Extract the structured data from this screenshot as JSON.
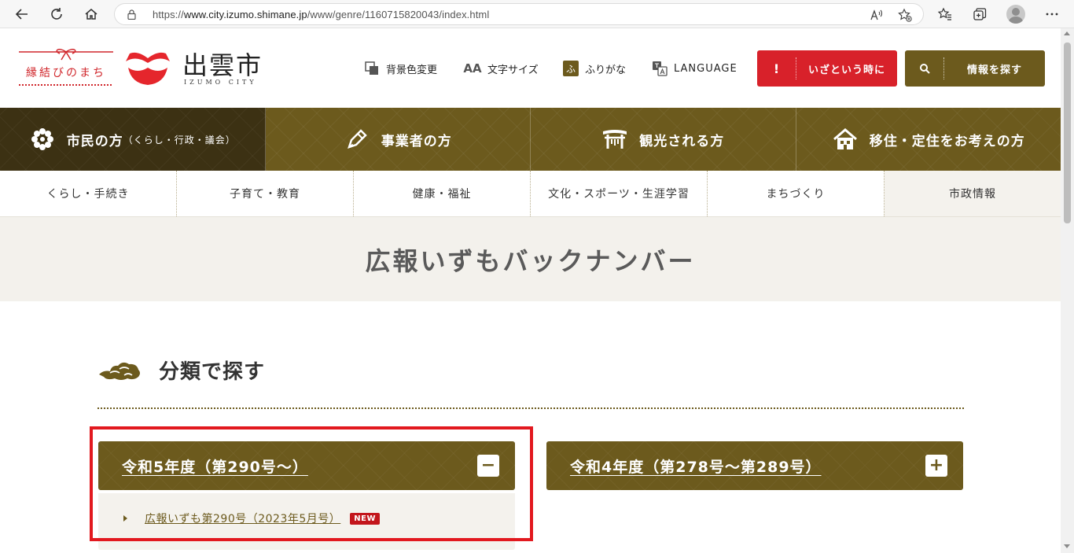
{
  "browser": {
    "url_prefix": "https://",
    "url_host": "www.city.izumo.shimane.jp",
    "url_path": "/www/genre/1160715820043/index.html",
    "read_aloud_label": "A͡",
    "icons": [
      "back-icon",
      "refresh-icon",
      "home-icon",
      "lock-icon",
      "read-aloud-icon",
      "add-favorite-icon",
      "favorites-icon",
      "collections-icon",
      "profile-icon",
      "more-icon"
    ]
  },
  "header": {
    "tagline": "縁結びのまち",
    "city_name": "出雲市",
    "city_name_en": "IZUMO CITY",
    "utilities": {
      "background_color": "背景色変更",
      "text_size": "文字サイズ",
      "text_size_icon": "AA",
      "furigana": "ふりがな",
      "furigana_icon": "ふ",
      "language": "LANGUAGE"
    },
    "emergency_button": {
      "icon": "!",
      "label": "いざという時に"
    },
    "search_button": {
      "label": "情報を探す"
    }
  },
  "main_nav": {
    "items": [
      {
        "label": "市民の方",
        "sub": "（くらし・行政・議会）",
        "icon": "flower-icon"
      },
      {
        "label": "事業者の方",
        "sub": "",
        "icon": "pen-icon"
      },
      {
        "label": "観光される方",
        "sub": "",
        "icon": "shrine-icon"
      },
      {
        "label": "移住・定住をお考えの方",
        "sub": "",
        "icon": "house-icon"
      }
    ]
  },
  "sub_nav": {
    "items": [
      "くらし・手続き",
      "子育て・教育",
      "健康・福祉",
      "文化・スポーツ・生涯学習",
      "まちづくり",
      "市政情報"
    ]
  },
  "page": {
    "title": "広報いずもバックナンバー"
  },
  "section": {
    "title": "分類で探す"
  },
  "accordions": [
    {
      "title": "令和5年度（第290号～）",
      "toggle": "−",
      "expanded": true,
      "links": [
        {
          "label": "広報いずも第290号（2023年5月号）",
          "badge": "NEW"
        }
      ]
    },
    {
      "title": "令和4年度（第278号～第289号）",
      "toggle": "+",
      "expanded": false
    }
  ],
  "colors": {
    "brand": "#6c5a1d",
    "brand_dark": "#3c3113",
    "emergency": "#d8212a",
    "highlight": "#e2191f",
    "band": "#f3f1ec"
  }
}
